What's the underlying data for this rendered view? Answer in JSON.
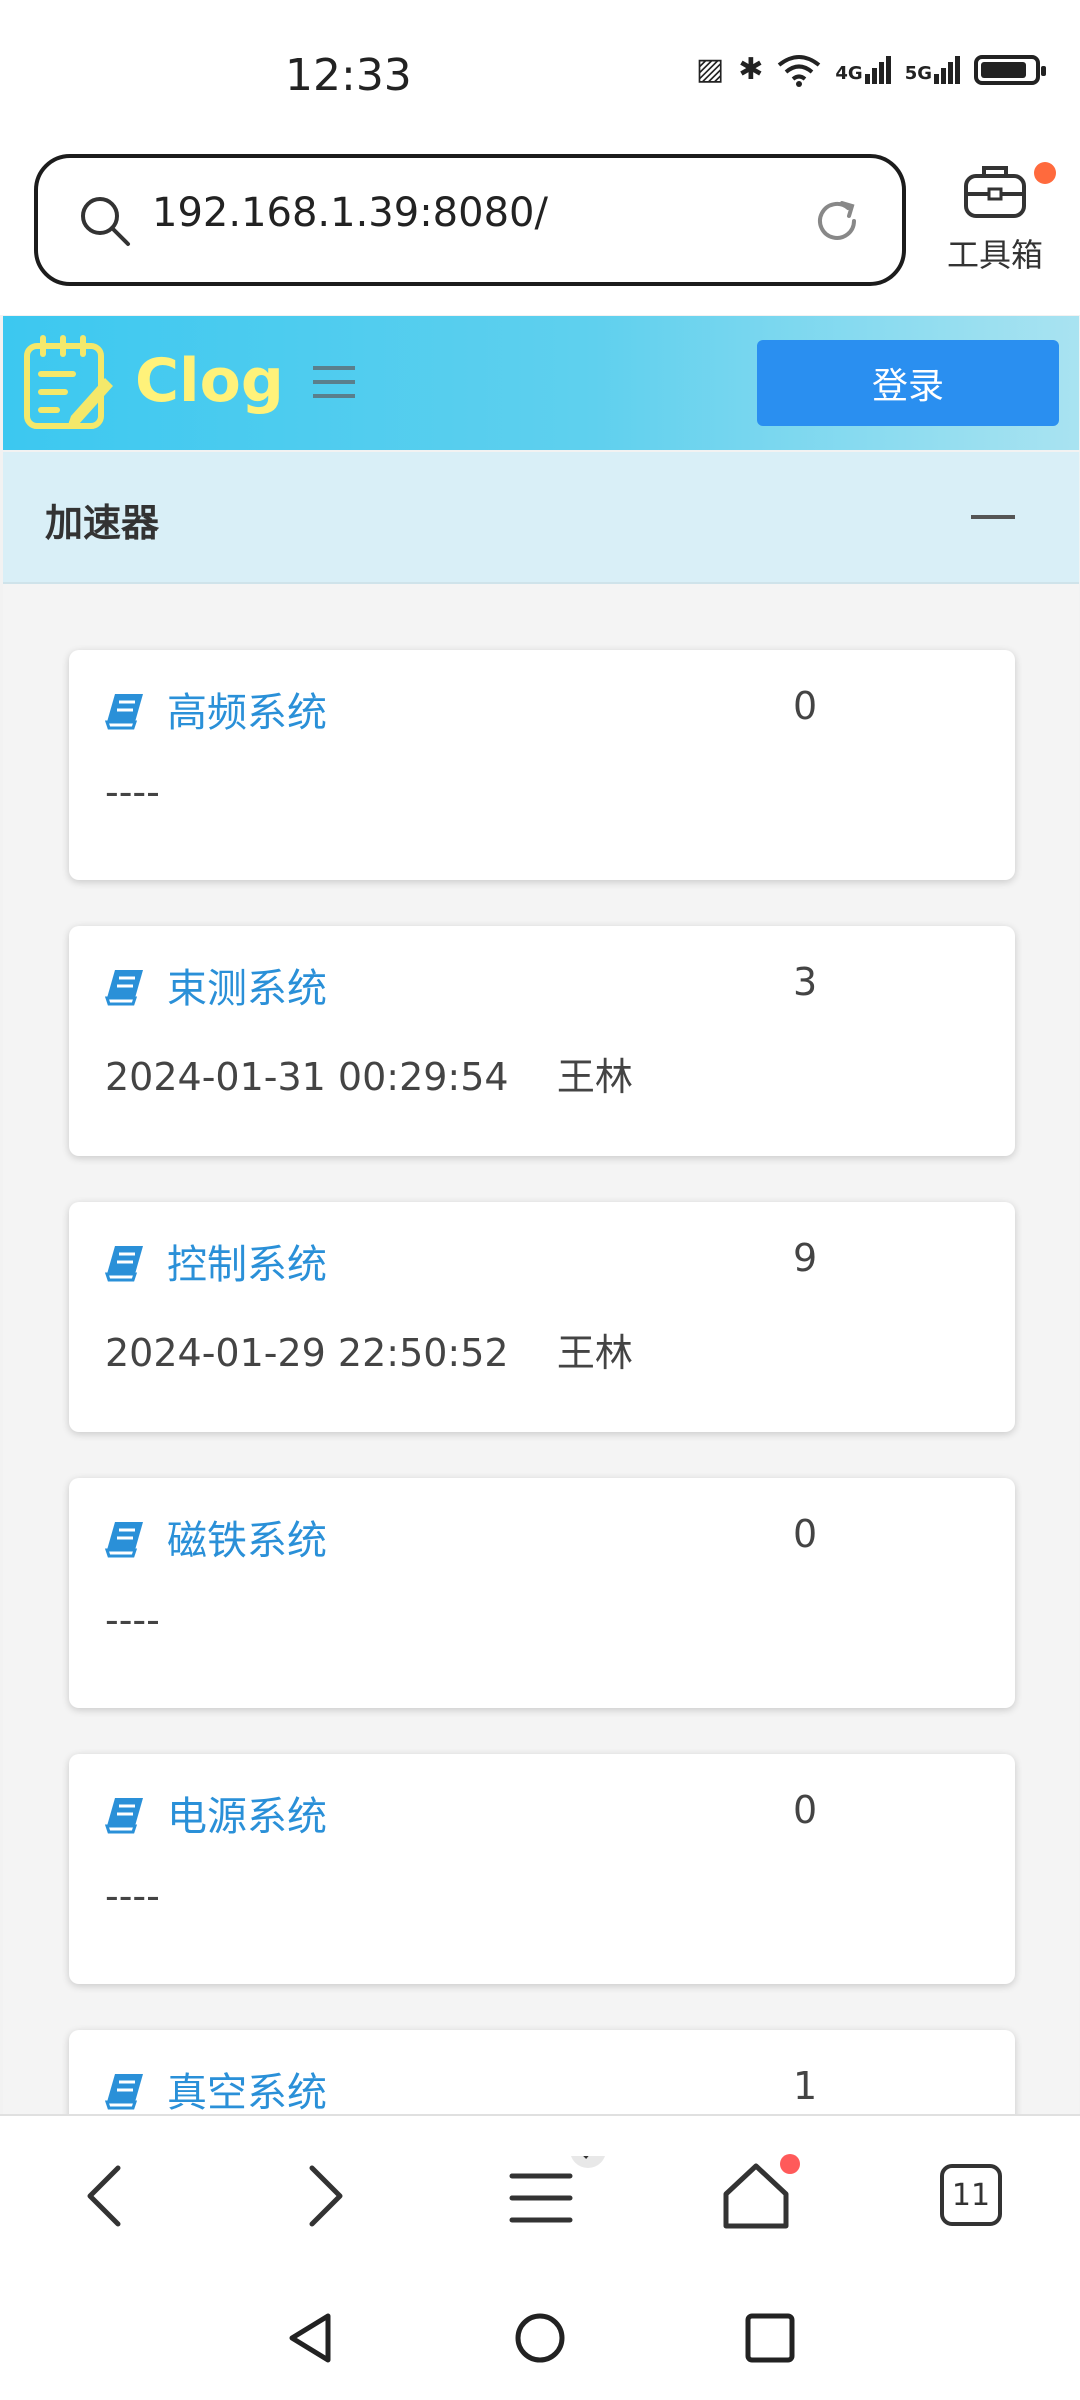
{
  "status_bar": {
    "time": "12:33",
    "signal_4g": "4G",
    "signal_5g": "5G"
  },
  "browser": {
    "url": "192.168.1.39:8080/",
    "toolbox_label": "工具箱",
    "tab_count": "11"
  },
  "site": {
    "logo_text": "Clog",
    "login_label": "登录"
  },
  "panel": {
    "title": "加速器",
    "items": [
      {
        "name": "高频系统",
        "count": "0",
        "meta": "----"
      },
      {
        "name": "束测系统",
        "count": "3",
        "meta": "2024-01-31 00:29:54    王林"
      },
      {
        "name": "控制系统",
        "count": "9",
        "meta": "2024-01-29 22:50:52    王林"
      },
      {
        "name": "磁铁系统",
        "count": "0",
        "meta": "----"
      },
      {
        "name": "电源系统",
        "count": "0",
        "meta": "----"
      },
      {
        "name": "真空系统",
        "count": "1",
        "meta": ""
      }
    ]
  },
  "colors": {
    "accent": "#2a90d8",
    "login_button": "#2a8ff0",
    "logo_text": "#fff27a",
    "header_start": "#3cc8f0",
    "panel_header": "#d9eff7"
  }
}
